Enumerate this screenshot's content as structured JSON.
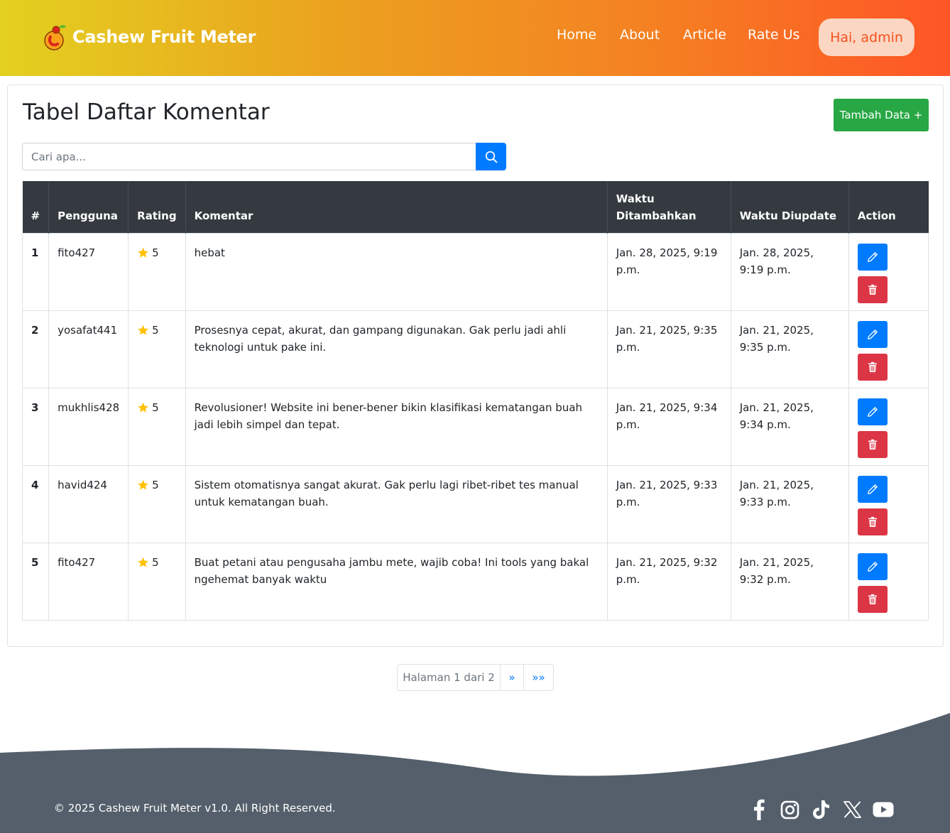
{
  "brand": {
    "name": "Cashew Fruit Meter"
  },
  "nav": {
    "items": [
      "Home",
      "About",
      "Article",
      "Rate Us"
    ],
    "user_greeting": "Hai, admin"
  },
  "main": {
    "title": "Tabel Daftar Komentar",
    "add_button": "Tambah Data +",
    "search_placeholder": "Cari apa..."
  },
  "table": {
    "headers": [
      "#",
      "Pengguna",
      "Rating",
      "Komentar",
      "Waktu Ditambahkan",
      "Waktu Diupdate",
      "Action"
    ],
    "rows": [
      {
        "no": "1",
        "user": "fito427",
        "rating": "5",
        "comment": "hebat",
        "added": "Jan. 28, 2025, 9:19 p.m.",
        "updated": "Jan. 28, 2025, 9:19 p.m."
      },
      {
        "no": "2",
        "user": "yosafat441",
        "rating": "5",
        "comment": "Prosesnya cepat, akurat, dan gampang digunakan. Gak perlu jadi ahli teknologi untuk pake ini.",
        "added": "Jan. 21, 2025, 9:35 p.m.",
        "updated": "Jan. 21, 2025, 9:35 p.m."
      },
      {
        "no": "3",
        "user": "mukhlis428",
        "rating": "5",
        "comment": "Revolusioner! Website ini bener-bener bikin klasifikasi kematangan buah jadi lebih simpel dan tepat.",
        "added": "Jan. 21, 2025, 9:34 p.m.",
        "updated": "Jan. 21, 2025, 9:34 p.m."
      },
      {
        "no": "4",
        "user": "havid424",
        "rating": "5",
        "comment": "Sistem otomatisnya sangat akurat. Gak perlu lagi ribet-ribet tes manual untuk kematangan buah.",
        "added": "Jan. 21, 2025, 9:33 p.m.",
        "updated": "Jan. 21, 2025, 9:33 p.m."
      },
      {
        "no": "5",
        "user": "fito427",
        "rating": "5",
        "comment": "Buat petani atau pengusaha jambu mete, wajib coba! Ini tools yang bakal ngehemat banyak waktu",
        "added": "Jan. 21, 2025, 9:32 p.m.",
        "updated": "Jan. 21, 2025, 9:32 p.m."
      }
    ]
  },
  "pagination": {
    "current": "Halaman 1 dari 2",
    "next": "»",
    "last": "»»"
  },
  "footer": {
    "copyright": "© 2025 Cashew Fruit Meter v1.0. All Right Reserved.",
    "social_icons": [
      "facebook-icon",
      "instagram-icon",
      "tiktok-icon",
      "x-icon",
      "youtube-icon"
    ]
  },
  "colors": {
    "header_gradient_start": "#e3d01f",
    "header_gradient_end": "#fe5526",
    "add_button": "#28a745",
    "edit_button": "#007bff",
    "delete_button": "#dc3545",
    "table_header": "#343a40",
    "footer": "#545f6b",
    "star": "#ffc107"
  }
}
